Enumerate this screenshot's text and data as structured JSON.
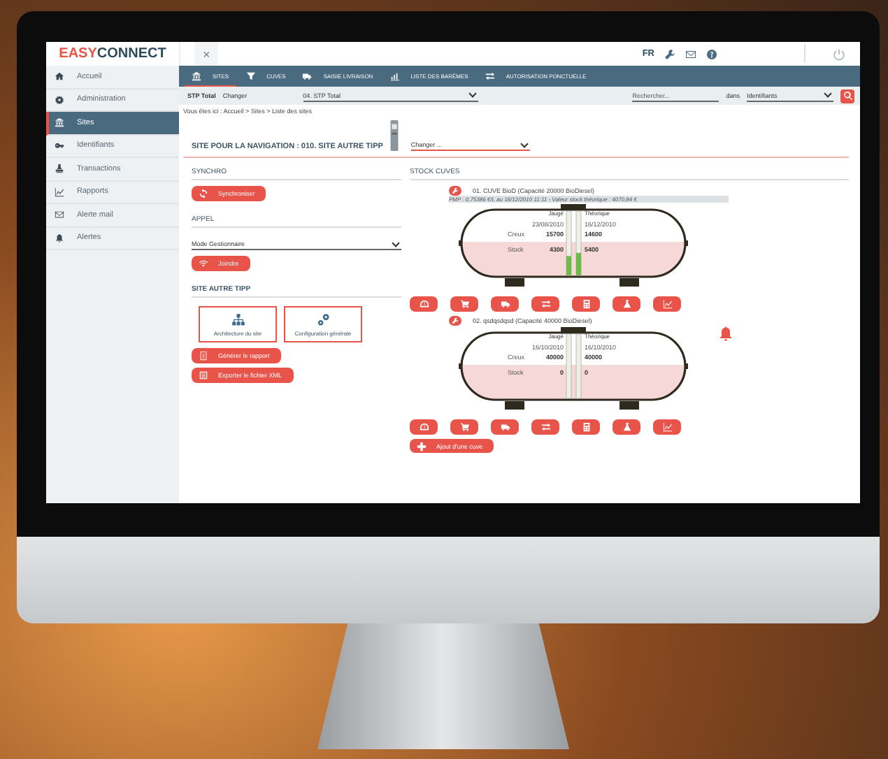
{
  "logo": {
    "first": "EASY",
    "second": "CONNECT"
  },
  "header": {
    "close": "×",
    "language": "FR"
  },
  "sidebar": {
    "items": [
      {
        "label": "Accueil",
        "selected": false
      },
      {
        "label": "Administration",
        "selected": false
      },
      {
        "label": "Sites",
        "selected": true
      },
      {
        "label": "Identifiants",
        "selected": false
      },
      {
        "label": "Transactions",
        "selected": false
      },
      {
        "label": "Rapports",
        "selected": false
      },
      {
        "label": "Alerte mail",
        "selected": false
      },
      {
        "label": "Alertes",
        "selected": false
      }
    ]
  },
  "nav": {
    "items": [
      {
        "label": "SITES",
        "selected": true
      },
      {
        "label": "CUVES",
        "selected": false
      },
      {
        "label": "SAISIE LIVRAISON",
        "selected": false
      },
      {
        "label": "LISTE DES BARÈMES",
        "selected": false
      },
      {
        "label": "AUTORISATION PONCTUELLE",
        "selected": false
      }
    ]
  },
  "subbar": {
    "station": "STP Total",
    "change": "Changer",
    "station_select": "04. STP Total",
    "search_placeholder": "Rechercher...",
    "in": "dans",
    "scope_select": "Identifiants"
  },
  "breadcrumb": "Vous êtes ici : Accueil > Sites > Liste des sites",
  "site": {
    "title": "SITE POUR LA NAVIGATION : 010. SITE AUTRE TIPP",
    "select": "Changer ..."
  },
  "left": {
    "synchro": {
      "title": "SYNCHRO",
      "button": "Synchroniser"
    },
    "appel": {
      "title": "APPEL",
      "mode": "Mode Gestionnaire",
      "button": "Joindre"
    },
    "tipp": {
      "title": "SITE AUTRE TIPP",
      "tiles": [
        "Architecture du site",
        "Configuration générale"
      ],
      "buttons": [
        "Générer le rapport",
        "Exporter le fichier XML"
      ]
    }
  },
  "stock": {
    "title": "STOCK CUVES",
    "tanks": [
      {
        "name": "01. CUVE BioD (Capacité 20000  BioDiesel)",
        "meta": "PMP : 0,75386 €/L au 16/12/2010 11:11 - Valeur stock théorique : 4070,84 €",
        "alert": false,
        "row_labels": [
          "Creux",
          "Stock"
        ],
        "columns": [
          {
            "header": "Jaugé",
            "date": "23/08/2010",
            "creux": "15700",
            "stock": "4300",
            "level": 0.3
          },
          {
            "header": "Théorique",
            "date": "16/12/2010",
            "creux": "14600",
            "stock": "5400",
            "level": 0.35
          }
        ]
      },
      {
        "name": "02. qsdqsdqsd (Capacité 40000  BioDiesel)",
        "alert": true,
        "row_labels": [
          "Creux",
          "Stock"
        ],
        "columns": [
          {
            "header": "Jaugé",
            "date": "16/10/2010",
            "creux": "40000",
            "stock": "0"
          },
          {
            "header": "Théorique",
            "date": "16/10/2010",
            "creux": "40000",
            "stock": "0"
          }
        ]
      }
    ],
    "add_button": "Ajout d'une cuve"
  }
}
